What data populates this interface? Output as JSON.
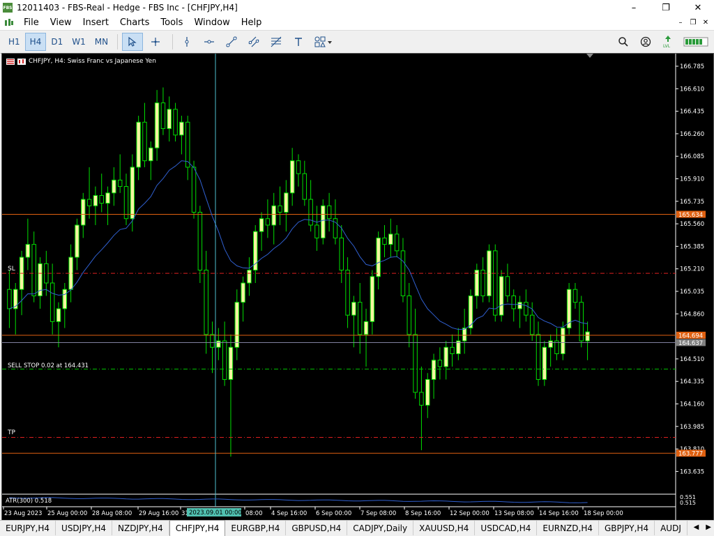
{
  "window": {
    "title": "12011403 - FBS-Real - Hedge - FBS Inc - [CHFJPY,H4]",
    "app_icon_text": "FBS",
    "minimize": "–",
    "maximize": "❐",
    "close": "✕"
  },
  "menu": {
    "items": [
      "File",
      "View",
      "Insert",
      "Charts",
      "Tools",
      "Window",
      "Help"
    ]
  },
  "toolbar": {
    "timeframes": [
      "H1",
      "H4",
      "D1",
      "W1",
      "MN"
    ],
    "active_timeframe": "H4",
    "lvl_label": "LVL"
  },
  "chart": {
    "symbol_title": "CHFJPY, H4:  Swiss Franc vs Japanese Yen",
    "sl_label": "SL",
    "tp_label": "TP",
    "sell_stop_label": "SELL STOP 0.02 at 164.431",
    "atr_label": "ATR(300) 0.518",
    "cursor_time_label": "2023.09.01 00:00",
    "price_ticks": [
      "166.785",
      "166.610",
      "166.435",
      "166.260",
      "166.085",
      "165.910",
      "165.735",
      "165.560",
      "165.385",
      "165.210",
      "165.035",
      "164.860",
      "164.510",
      "164.335",
      "164.160",
      "163.985",
      "163.810",
      "163.635"
    ],
    "price_tags": [
      {
        "value": "165.634",
        "color": "#e06010"
      },
      {
        "value": "164.694",
        "color": "#e06010"
      },
      {
        "value": "164.637",
        "color": "#808080"
      },
      {
        "value": "163.777",
        "color": "#e06010"
      }
    ],
    "atr_ticks": [
      "0.551",
      "0.515"
    ],
    "time_labels": [
      "23 Aug 2023",
      "25 Aug 00:00",
      "28 Aug 08:00",
      "29 Aug 16:00",
      "31",
      "08:00",
      "4 Sep 16:00",
      "6 Sep 00:00",
      "7 Sep 08:00",
      "8 Sep 16:00",
      "12 Sep 00:00",
      "13 Sep 08:00",
      "14 Sep 16:00",
      "18 Sep 00:00"
    ],
    "colors": {
      "background": "#000000",
      "bull_body": "#f5f5a0",
      "bear_body": "#000000",
      "candle_line": "#00e000",
      "ma": "#3060d0",
      "sl_tp_line": "#e02020",
      "sell_stop_line": "#00c000",
      "cursor_line": "#50c0d0"
    }
  },
  "tabs": {
    "items": [
      "EURJPY,H4",
      "USDJPY,H4",
      "NZDJPY,H4",
      "CHFJPY,H4",
      "EURGBP,H4",
      "GBPUSD,H4",
      "CADJPY,Daily",
      "XAUUSD,H4",
      "USDCAD,H4",
      "EURNZD,H4",
      "GBPJPY,H4",
      "AUDJ"
    ],
    "active": "CHFJPY,H4",
    "left_arrow": "◀",
    "right_arrow": "▶"
  }
}
